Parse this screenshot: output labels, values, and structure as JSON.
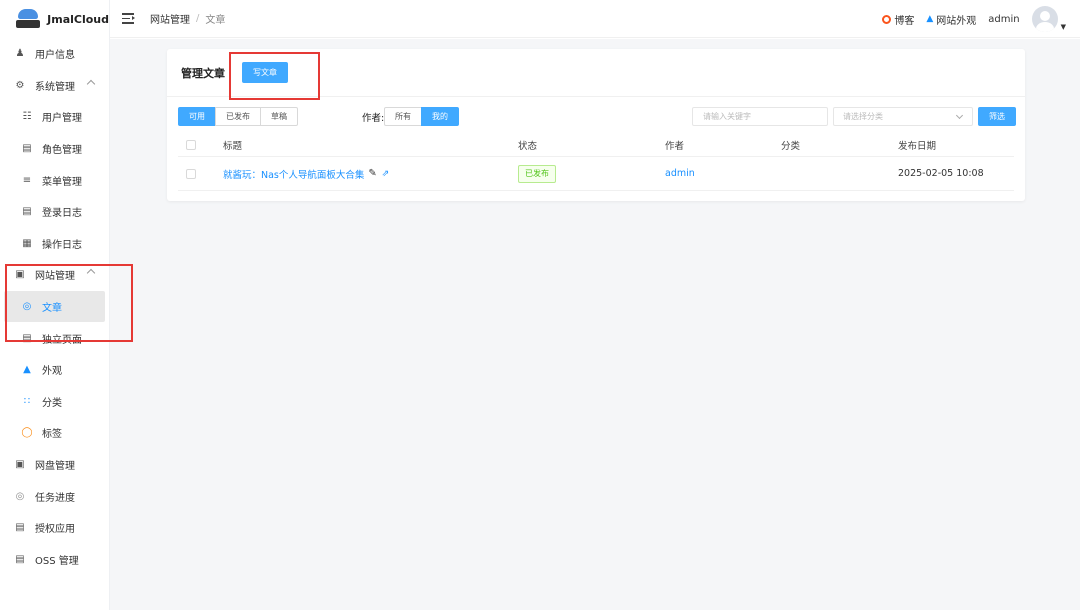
{
  "app": {
    "name": "JmalCloud"
  },
  "sidebar": {
    "items": [
      {
        "label": "用户信息",
        "icon": "user-icon"
      },
      {
        "label": "系统管理",
        "icon": "gear-icon",
        "expanded": true
      },
      {
        "label": "用户管理",
        "icon": "users-icon"
      },
      {
        "label": "角色管理",
        "icon": "id-card-icon"
      },
      {
        "label": "菜单管理",
        "icon": "sliders-icon"
      },
      {
        "label": "登录日志",
        "icon": "log-icon"
      },
      {
        "label": "操作日志",
        "icon": "operation-log-icon"
      },
      {
        "label": "网站管理",
        "icon": "website-icon",
        "expanded": true
      },
      {
        "label": "文章",
        "icon": "article-icon",
        "active": true
      },
      {
        "label": "独立页面",
        "icon": "page-icon"
      },
      {
        "label": "外观",
        "icon": "shirt-icon"
      },
      {
        "label": "分类",
        "icon": "category-icon"
      },
      {
        "label": "标签",
        "icon": "tag-icon"
      },
      {
        "label": "网盘管理",
        "icon": "disk-icon"
      },
      {
        "label": "任务进度",
        "icon": "progress-icon"
      },
      {
        "label": "授权应用",
        "icon": "auth-app-icon"
      },
      {
        "label": "OSS 管理",
        "icon": "oss-icon"
      }
    ]
  },
  "header": {
    "breadcrumb": [
      "网站管理",
      "文章"
    ],
    "separator": "/",
    "blog_label": "博客",
    "appearance_label": "网站外观",
    "username": "admin"
  },
  "card": {
    "title": "管理文章",
    "write_button": "写文章"
  },
  "filters": {
    "status_tabs": [
      "可用",
      "已发布",
      "草稿"
    ],
    "status_selected": "可用",
    "author_label": "作者:",
    "author_tabs": [
      "所有",
      "我的"
    ],
    "author_selected": "我的",
    "keyword_placeholder": "请输入关键字",
    "category_placeholder": "请选择分类",
    "filter_button": "筛选"
  },
  "table": {
    "columns": [
      "标题",
      "状态",
      "作者",
      "分类",
      "发布日期"
    ],
    "rows": [
      {
        "title": "就酱玩：Nas个人导航面板大合集",
        "status": "已发布",
        "author": "admin",
        "category": "",
        "date": "2025-02-05 10:08"
      }
    ]
  },
  "colors": {
    "primary": "#1890ff",
    "button": "#40a9ff",
    "success": "#52c41a",
    "annotation": "#e53935"
  }
}
